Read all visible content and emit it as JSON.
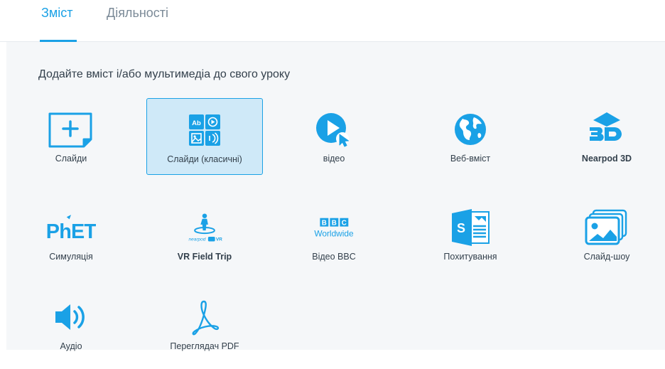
{
  "tabs": [
    {
      "label": "Зміст",
      "active": true
    },
    {
      "label": "Діяльності",
      "active": false
    }
  ],
  "heading": "Додайте вміст і/або мультимедіа до свого уроку",
  "accent_color": "#1aa1e6",
  "tiles": [
    {
      "label": "Слайди",
      "icon": "add-slide-icon",
      "selected": false
    },
    {
      "label": "Слайди (класичні)",
      "icon": "classic-slides-icon",
      "selected": true
    },
    {
      "label": "відео",
      "icon": "video-play-icon",
      "selected": false
    },
    {
      "label": "Веб-вміст",
      "icon": "globe-icon",
      "selected": false
    },
    {
      "label": "Nearpod 3D",
      "icon": "3d-icon",
      "selected": false
    },
    {
      "label": "Симуляція",
      "icon": "phet-logo-icon",
      "selected": false,
      "logo_text": "PhET"
    },
    {
      "label": "VR Field Trip",
      "icon": "vr-field-trip-icon",
      "selected": false,
      "logo_text": "nearpod VR"
    },
    {
      "label": "Відео BBC",
      "icon": "bbc-worldwide-logo-icon",
      "selected": false,
      "logo_text": "BBC Worldwide"
    },
    {
      "label": "Похитування",
      "icon": "sharepoint-icon",
      "selected": false
    },
    {
      "label": "Слайд-шоу",
      "icon": "slideshow-icon",
      "selected": false
    },
    {
      "label": "Аудіо",
      "icon": "speaker-icon",
      "selected": false
    },
    {
      "label": "Переглядач PDF",
      "icon": "pdf-icon",
      "selected": false
    }
  ]
}
